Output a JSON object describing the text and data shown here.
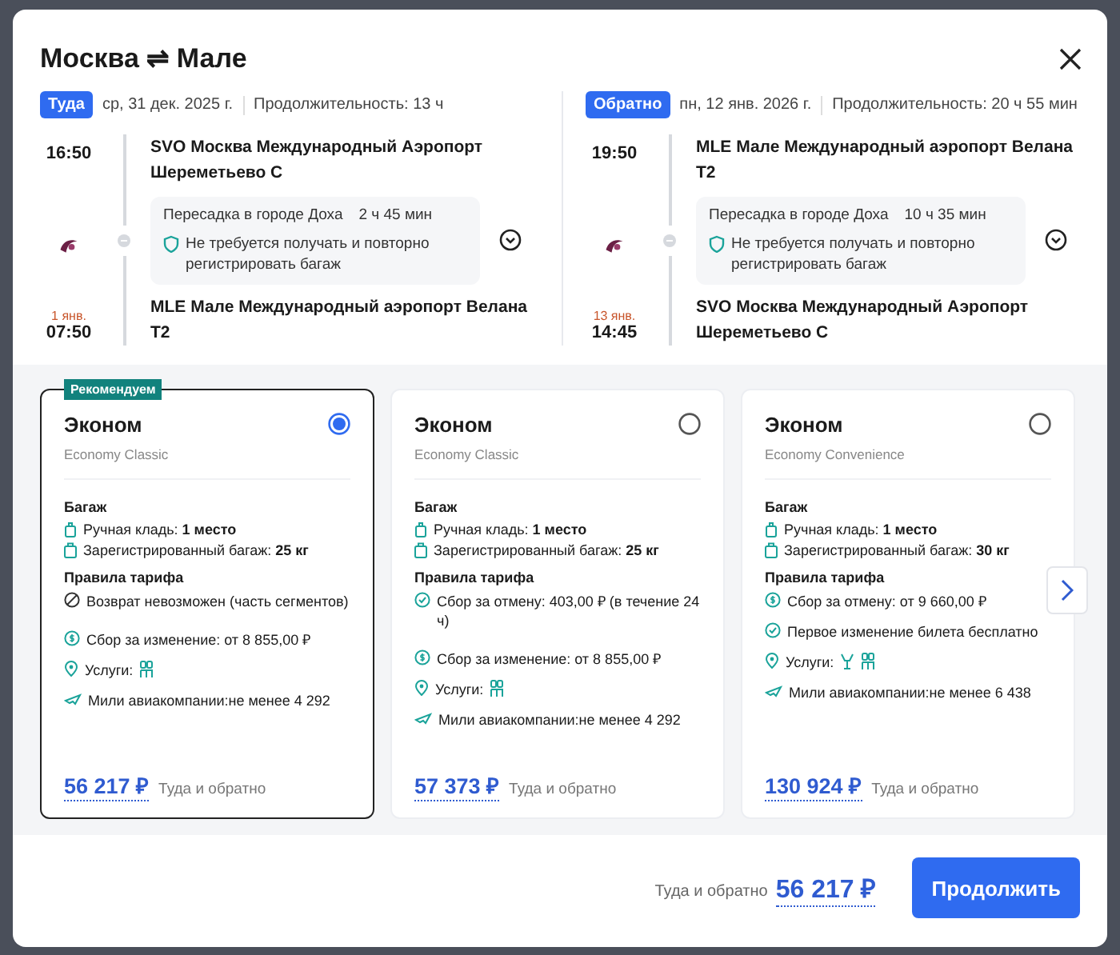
{
  "title": {
    "from": "Москва",
    "symbol": "⇌",
    "to": "Мале"
  },
  "legs": [
    {
      "badge": "Туда",
      "date": "ср, 31 дек. 2025 г.",
      "duration": "Продолжительность: 13 ч",
      "dep_time": "16:50",
      "dep_airport": "SVO Москва Международный Аэропорт Шереметьево C",
      "transfer_city": "Пересадка в городе Доха",
      "transfer_time": "2 ч 45 мин",
      "baggage_note": "Не требуется получать и повторно регистрировать багаж",
      "arr_date_note": "1 янв.",
      "arr_time": "07:50",
      "arr_airport": "MLE Мале Международный аэропорт Велана T2"
    },
    {
      "badge": "Обратно",
      "date": "пн, 12 янв. 2026 г.",
      "duration": "Продолжительность: 20 ч 55 мин",
      "dep_time": "19:50",
      "dep_airport": "MLE Мале Международный аэропорт Велана T2",
      "transfer_city": "Пересадка в городе Доха",
      "transfer_time": "10 ч 35 мин",
      "baggage_note": "Не требуется получать и повторно регистрировать багаж",
      "arr_date_note": "13 янв.",
      "arr_time": "14:45",
      "arr_airport": "SVO Москва Международный Аэропорт Шереметьево C"
    }
  ],
  "fares": [
    {
      "tag": "Рекомендуем",
      "name": "Эконом",
      "subtitle": "Economy Classic",
      "selected": true,
      "baggage_title": "Багаж",
      "baggage": [
        {
          "kind": "hand",
          "label": "Ручная кладь:",
          "value": "1 место"
        },
        {
          "kind": "checked",
          "label": "Зарегистрированный багаж:",
          "value": "25 кг"
        }
      ],
      "rules_title": "Правила тарифа",
      "rules": [
        {
          "kind": "no",
          "text": "Возврат невозможен (часть сегментов)"
        },
        {
          "kind": "fee",
          "text": "Сбор за изменение: от 8 855,00 ₽"
        },
        {
          "kind": "services",
          "text": "Услуги:",
          "services": [
            {
              "kind": "seat"
            }
          ]
        },
        {
          "kind": "miles",
          "text": "Мили авиакомпании:не менее 4 292"
        }
      ],
      "price": "56 217 ₽",
      "price_note": "Туда и обратно"
    },
    {
      "name": "Эконом",
      "subtitle": "Economy Classic",
      "selected": false,
      "baggage_title": "Багаж",
      "baggage": [
        {
          "kind": "hand",
          "label": "Ручная кладь:",
          "value": "1 место"
        },
        {
          "kind": "checked",
          "label": "Зарегистрированный багаж:",
          "value": "25 кг"
        }
      ],
      "rules_title": "Правила тарифа",
      "rules": [
        {
          "kind": "yes",
          "text": "Сбор за отмену: 403,00 ₽ (в течение 24 ч)"
        },
        {
          "kind": "fee",
          "text": "Сбор за изменение: от 8 855,00 ₽"
        },
        {
          "kind": "services",
          "text": "Услуги:",
          "services": [
            {
              "kind": "seat"
            }
          ]
        },
        {
          "kind": "miles",
          "text": "Мили авиакомпании:не менее 4 292"
        }
      ],
      "price": "57 373 ₽",
      "price_note": "Туда и обратно"
    },
    {
      "name": "Эконом",
      "subtitle": "Economy Convenience",
      "selected": false,
      "baggage_title": "Багаж",
      "baggage": [
        {
          "kind": "hand",
          "label": "Ручная кладь:",
          "value": "1 место"
        },
        {
          "kind": "checked",
          "label": "Зарегистрированный багаж:",
          "value": "30 кг"
        }
      ],
      "rules_title": "Правила тарифа",
      "rules": [
        {
          "kind": "fee",
          "text": "Сбор за отмену: от 9 660,00 ₽"
        },
        {
          "kind": "yes",
          "text": "Первое изменение билета бесплатно"
        },
        {
          "kind": "services",
          "text": "Услуги:",
          "services": [
            {
              "kind": "meal"
            },
            {
              "kind": "seat"
            }
          ]
        },
        {
          "kind": "miles",
          "text": "Мили авиакомпании:не менее 6 438"
        }
      ],
      "price": "130 924 ₽",
      "price_note": "Туда и обратно"
    }
  ],
  "footer": {
    "note": "Туда и обратно",
    "price": "56 217 ₽",
    "button": "Продолжить"
  }
}
